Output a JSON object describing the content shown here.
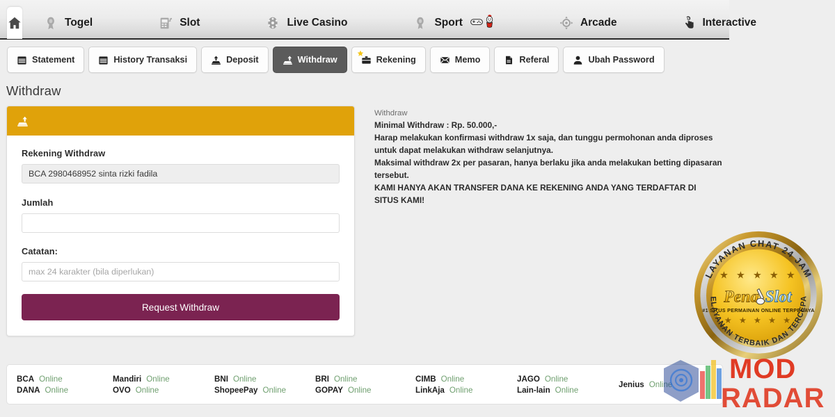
{
  "colors": {
    "page_background": "#eeeeee",
    "nav_active_tab": "#ffffff",
    "subtab_active_background": "#5b5b5b",
    "card_header_orange": "#e0a20a",
    "submit_button_maroon": "#7b2351",
    "status_online_green": "#6f9f6f",
    "watermark_red": "#e03b24"
  },
  "topnav": {
    "items": [
      {
        "label": "",
        "icon": "home-icon",
        "active": true,
        "name": "home"
      },
      {
        "label": "Togel",
        "icon": "togel-icon",
        "active": false,
        "name": "togel"
      },
      {
        "label": "Slot",
        "icon": "slot-machine-icon",
        "active": false,
        "name": "slot"
      },
      {
        "label": "Live Casino",
        "icon": "casino-chip-icon",
        "active": false,
        "name": "live-casino"
      },
      {
        "label": "Sport",
        "icon": "sport-icon",
        "active": false,
        "name": "sport"
      },
      {
        "label": "Arcade",
        "icon": "arcade-target-icon",
        "active": false,
        "name": "arcade"
      },
      {
        "label": "Interactive",
        "icon": "pointing-hand-icon",
        "active": false,
        "name": "interactive"
      }
    ],
    "sport_badges": [
      "gamepad-icon",
      "mascot-badge-icon"
    ]
  },
  "subtabs": {
    "items": [
      {
        "label": "Statement",
        "icon": "calendar-icon",
        "active": false
      },
      {
        "label": "History Transaksi",
        "icon": "calendar-icon",
        "active": false
      },
      {
        "label": "Deposit",
        "icon": "deposit-icon",
        "active": false
      },
      {
        "label": "Withdraw",
        "icon": "withdraw-icon",
        "active": true
      },
      {
        "label": "Rekening",
        "icon": "briefcase-icon",
        "active": false,
        "badge": "star-badge"
      },
      {
        "label": "Memo",
        "icon": "envelope-icon",
        "active": false
      },
      {
        "label": "Referal",
        "icon": "referal-icon",
        "active": false
      },
      {
        "label": "Ubah Password",
        "icon": "user-icon",
        "active": false
      }
    ]
  },
  "page": {
    "title": "Withdraw"
  },
  "form": {
    "header_icon": "withdraw-icon",
    "rekening_label": "Rekening Withdraw",
    "rekening_value": "BCA 2980468952 sinta rizki fadila",
    "jumlah_label": "Jumlah",
    "jumlah_value": "",
    "jumlah_placeholder": "",
    "catatan_label": "Catatan:",
    "catatan_value": "",
    "catatan_placeholder": "max 24 karakter (bila diperlukan)",
    "submit_label": "Request Withdraw"
  },
  "info": {
    "heading": "Withdraw",
    "lines": [
      "Minimal Withdraw : Rp. 50.000,-",
      "Harap melakukan konfirmasi withdraw 1x saja, dan tunggu permohonan anda diproses untuk dapat melakukan withdraw selanjutnya.",
      "Maksimal withdraw 2x per pasaran, hanya berlaku jika anda melakukan betting dipasaran tersebut.",
      "KAMI HANYA AKAN TRANSFER DANA KE REKENING ANDA YANG TERDAFTAR DI SITUS KAMI!"
    ],
    "line1": "Minimal Withdraw : Rp. 50.000,-",
    "line2": "Harap melakukan konfirmasi withdraw 1x saja, dan tunggu permohonan anda diproses untuk dapat melakukan withdraw selanjutnya.",
    "line3": "Maksimal withdraw 2x per pasaran, hanya berlaku jika anda melakukan betting dipasaran tersebut.",
    "line4": "KAMI HANYA AKAN TRANSFER DANA KE REKENING ANDA YANG TERDAFTAR DI SITUS KAMI!"
  },
  "bank_footer": {
    "columns": [
      {
        "rows": [
          {
            "name": "BCA",
            "status": "Online"
          },
          {
            "name": "DANA",
            "status": "Online"
          }
        ]
      },
      {
        "rows": [
          {
            "name": "Mandiri",
            "status": "Online"
          },
          {
            "name": "OVO",
            "status": "Online"
          }
        ]
      },
      {
        "rows": [
          {
            "name": "BNI",
            "status": "Online"
          },
          {
            "name": "ShopeePay",
            "status": "Online"
          }
        ]
      },
      {
        "rows": [
          {
            "name": "BRI",
            "status": "Online"
          },
          {
            "name": "GOPAY",
            "status": "Online"
          }
        ]
      },
      {
        "rows": [
          {
            "name": "CIMB",
            "status": "Online"
          },
          {
            "name": "LinkAja",
            "status": "Online"
          }
        ]
      },
      {
        "rows": [
          {
            "name": "JAGO",
            "status": "Online"
          },
          {
            "name": "Lain-lain",
            "status": "Online"
          }
        ]
      },
      {
        "rows": [
          {
            "name": "Jenius",
            "status": "Online"
          }
        ]
      }
    ]
  },
  "logo": {
    "arc_top": "LAYANAN CHAT 24 JAM",
    "arc_bottom": "PELAYANAN TERBAIK DAN TERCEPAT",
    "brand_primary": "Pena",
    "brand_secondary": "Slot",
    "tagline": "#1 SITUS PERMAINAN ONLINE TERPECAYA",
    "stars_top": "★ ★ ★ ★ ★",
    "stars_bottom": "★ ★ ★ ★ ★"
  },
  "watermark": {
    "line1": "MOD",
    "line2": "RADAR"
  }
}
